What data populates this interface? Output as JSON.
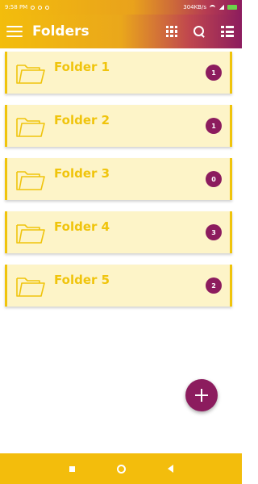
{
  "status_bar": {
    "time": "9:58 PM",
    "indicators": "304KB/s"
  },
  "app_bar": {
    "title": "Folders",
    "actions": [
      "grid-icon",
      "search-icon",
      "list-icon"
    ]
  },
  "folders": [
    {
      "name": "Folder 1",
      "count": "1"
    },
    {
      "name": "Folder 2",
      "count": "1"
    },
    {
      "name": "Folder 3",
      "count": "0"
    },
    {
      "name": "Folder 4",
      "count": "3"
    },
    {
      "name": "Folder 5",
      "count": "2"
    }
  ],
  "colors": {
    "accent_yellow": "#f0c40c",
    "accent_purple": "#8c1c5e",
    "card_background": "#fdf4c8"
  },
  "fab": {
    "icon": "plus-icon"
  },
  "nav_bar": {
    "buttons": [
      "recents-icon",
      "home-icon",
      "back-icon"
    ]
  }
}
